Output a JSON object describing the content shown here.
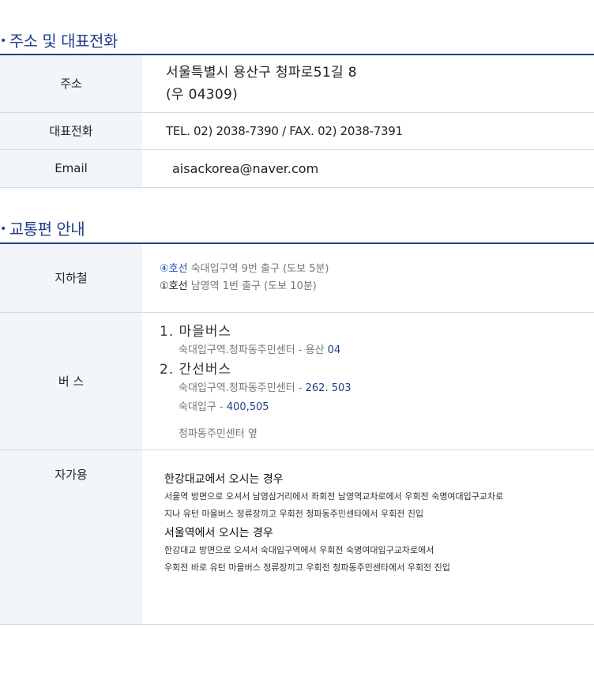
{
  "contact": {
    "title": "주소 및 대표전화",
    "address_label": "주소",
    "address_line1": "서울특별시 용산구 청파로51길 8",
    "address_line2": "(우 04309)",
    "phone_label": "대표전화",
    "phone_value": "TEL. 02) 2038-7390  /  FAX. 02) 2038-7391",
    "email_label": "Email",
    "email_value": "aisackorea@naver.com"
  },
  "transport": {
    "title": "교통편 안내",
    "subway_label": "지하철",
    "subway_lines": [
      {
        "line": "④호선",
        "desc": "숙대입구역 9번 출구 (도보 5분)"
      },
      {
        "line": "①호선",
        "desc": "남영역 1번 출구 (도보 10분)"
      }
    ],
    "bus_label": "버 스",
    "bus_village_title": "1. 마을버스",
    "bus_village_route": "숙대입구역.청파동주민센터 - 용산",
    "bus_village_num": "04",
    "bus_trunk_title": "2. 간선버스",
    "bus_trunk_route1": "숙대입구역.청파동주민센터 -",
    "bus_trunk_num1": "262. 503",
    "bus_trunk_route2": "숙대입구 -",
    "bus_trunk_num2": "400,505",
    "bus_note": "청파동주민센터 옆",
    "car_label": "자가용",
    "car_from_bridge_title": "한강대교에서 오시는 경우",
    "car_from_bridge_text1": "서울역 방면으로 오셔서 남영삼거리에서 좌회전 남영역교차로에서 우회전 숙명여대입구교차로",
    "car_from_bridge_text2": "지나 유턴 마을버스 정류장끼고 우회전 청파동주민센타에서 우회전 진입",
    "car_from_station_title": "서울역에서 오시는 경우",
    "car_from_station_text1": "한강대교 방면으로 오셔서 숙대입구역에서 우회전 숙명여대입구교차로에서",
    "car_from_station_text2": "우회전  바로 유턴 마을버스 정류장끼고 우회전 청파동주민센타에서 우회전 진입"
  }
}
